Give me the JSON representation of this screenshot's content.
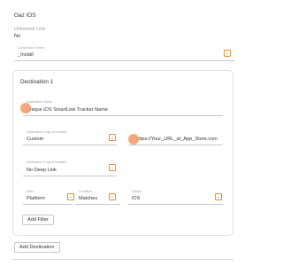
{
  "section_title": "Gaz iOS",
  "universal_link": {
    "label": "Universal Link",
    "value": "No"
  },
  "conversion_events": {
    "label": "Conversion Events",
    "value": "_Install"
  },
  "destination": {
    "title": "Destination 1",
    "name": {
      "label": "Destination Name",
      "value": "Unique iOS SmartLink Tracker Name"
    },
    "if_installed": {
      "label": "Destination if app is installed",
      "value": "Custom"
    },
    "custom_url": {
      "value": "https://Your_URL_at_App_Store.com"
    },
    "if_not_installed": {
      "label": "Destination if app is installed",
      "value": "No Deep Link"
    },
    "filter": {
      "filter": {
        "label": "Filter",
        "value": "Platform"
      },
      "condition": {
        "label": "Condition",
        "value": "Matches"
      },
      "values": {
        "label": "Values",
        "value": "iOS"
      }
    },
    "add_filter_label": "Add Filter"
  },
  "add_destination_label": "Add Destination",
  "dropdown_glyph": "⌄",
  "colors": {
    "accent": "#f08a24",
    "marker": "#f4a071"
  }
}
